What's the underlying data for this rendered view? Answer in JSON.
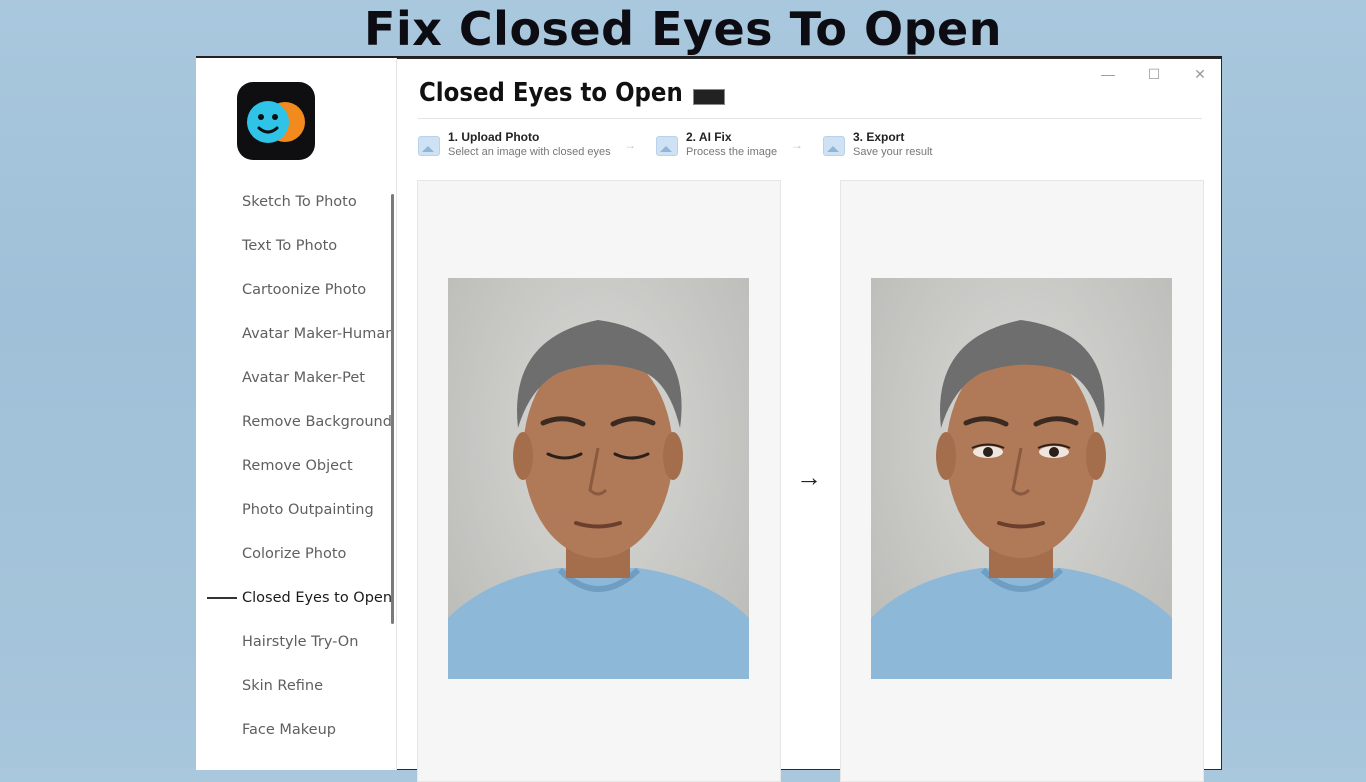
{
  "banner": {
    "text": "Fix Closed Eyes To Open"
  },
  "page": {
    "title": "Closed Eyes to Open"
  },
  "window_controls": {
    "minimize": "—",
    "maximize": "☐",
    "close": "✕"
  },
  "steps": [
    {
      "title": "1. Upload Photo",
      "subtitle": "Select an image with closed eyes"
    },
    {
      "title": "2. AI Fix",
      "subtitle": "Process the image"
    },
    {
      "title": "3. Export",
      "subtitle": "Save your result"
    }
  ],
  "step_arrow": "→",
  "sidebar": {
    "items": [
      {
        "label": "Sketch To Photo"
      },
      {
        "label": "Text To Photo"
      },
      {
        "label": "Cartoonize Photo"
      },
      {
        "label": "Avatar Maker-Human"
      },
      {
        "label": "Avatar Maker-Pet"
      },
      {
        "label": "Remove Background"
      },
      {
        "label": "Remove Object"
      },
      {
        "label": "Photo Outpainting"
      },
      {
        "label": "Colorize Photo"
      },
      {
        "label": "Closed Eyes to Open",
        "active": true
      },
      {
        "label": "Hairstyle Try-On"
      },
      {
        "label": "Skin Refine"
      },
      {
        "label": "Face Makeup"
      }
    ]
  },
  "compare_arrow": "→",
  "colors": {
    "accent": "#1a1a1a",
    "shirt": "#8db8d8",
    "skin": "#b07a58",
    "hair": "#6e6e6e"
  }
}
